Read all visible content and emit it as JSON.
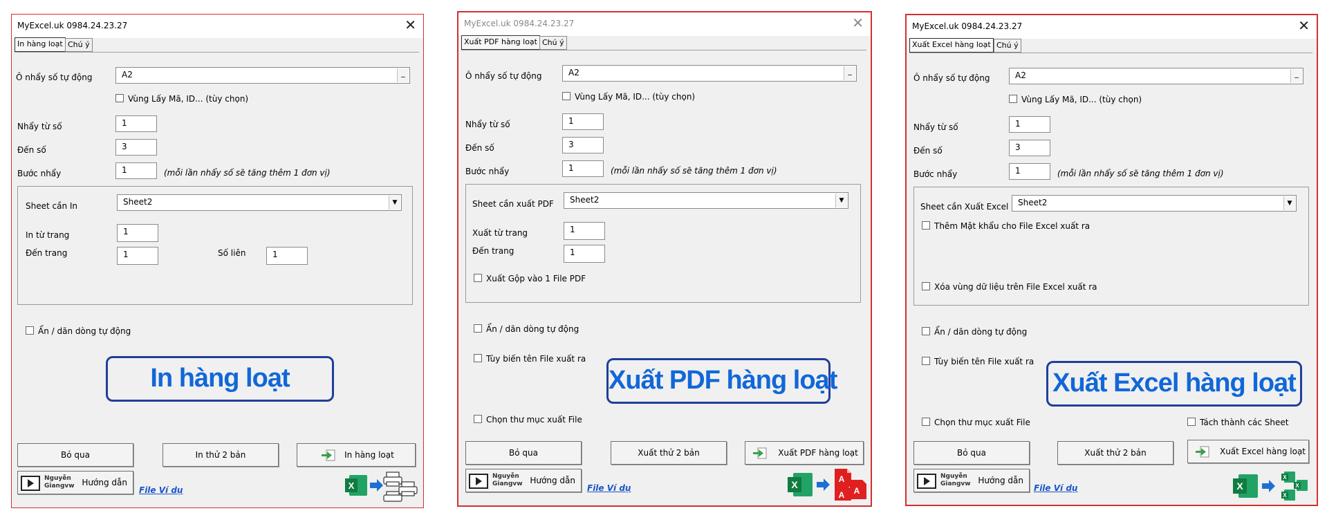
{
  "dialogs": [
    {
      "title": "MyExcel.uk     0984.24.23.27",
      "close": "✕",
      "tabs": [
        "In hàng loạt",
        "Chú ý"
      ],
      "auto_number_label": "Ô nhẩy số tự động",
      "auto_number_value": "A2",
      "id_range_checkbox": "Vùng Lấy Mã, ID... (tùy chọn)",
      "from_label": "Nhẩy từ số",
      "from_value": "1",
      "to_label": "Đến số",
      "to_value": "3",
      "step_label": "Bước nhẩy",
      "step_value": "1",
      "step_note": "(mỗi lần nhẩy số sẽ tăng thêm    1  đơn vị)",
      "sheet_label": "Sheet cần In",
      "sheet_value": "Sheet2",
      "page_from_label": "In từ trang",
      "page_from_value": "1",
      "page_to_label": "Đến trang",
      "page_to_value": "1",
      "copies_label": "Số liên",
      "copies_value": "1",
      "auto_hide_checkbox": "Ẩn / dãn dòng tự động",
      "banner": "In hàng loạt",
      "skip_button": "Bỏ qua",
      "test_button": "In thử 2 bản",
      "run_button": "In hàng loạt",
      "help_brand_line1": "Nguyễn",
      "help_brand_line2": "Giangvw",
      "help_button": "Hướng dẫn",
      "example_link": "File Ví dụ",
      "bottom_icons": [
        "excel-icon",
        "arrow-right-icon",
        "printer-icon"
      ]
    },
    {
      "title": "MyExcel.uk     0984.24.23.27",
      "close": "✕",
      "tabs": [
        "Xuất PDF hàng loạt",
        "Chú ý"
      ],
      "auto_number_label": "Ô nhẩy số tự động",
      "auto_number_value": "A2",
      "id_range_checkbox": "Vùng Lấy Mã, ID... (tùy chọn)",
      "from_label": "Nhẩy từ số",
      "from_value": "1",
      "to_label": "Đến số",
      "to_value": "3",
      "step_label": "Bước nhẩy",
      "step_value": "1",
      "step_note": "(mỗi lần nhẩy số sẽ tăng thêm    1  đơn vị)",
      "sheet_label": "Sheet cần xuất PDF",
      "sheet_value": "Sheet2",
      "page_from_label": "Xuất từ trang",
      "page_from_value": "1",
      "page_to_label": "Đến trang",
      "page_to_value": "1",
      "merge_checkbox": "Xuất Gộp vào 1 File PDF",
      "auto_hide_checkbox": "Ẩn / dãn dòng tự động",
      "rename_checkbox": "Tùy biến tên File xuất ra",
      "folder_checkbox": "Chọn thư mục xuất File",
      "banner": "Xuất PDF hàng loạt",
      "skip_button": "Bỏ qua",
      "test_button": "Xuất thử 2 bản",
      "run_button": "Xuất PDF hàng loạt",
      "help_brand_line1": "Nguyễn",
      "help_brand_line2": "Giangvw",
      "help_button": "Hướng dẫn",
      "example_link": "File Ví dụ",
      "bottom_icons": [
        "excel-icon",
        "arrow-right-icon",
        "pdf-icon"
      ]
    },
    {
      "title": "MyExcel.uk     0984.24.23.27",
      "close": "✕",
      "tabs": [
        "Xuất Excel hàng loạt",
        "Chú ý"
      ],
      "auto_number_label": "Ô nhẩy số tự động",
      "auto_number_value": "A2",
      "id_range_checkbox": "Vùng Lấy Mã, ID... (tùy chọn)",
      "from_label": "Nhẩy từ số",
      "from_value": "1",
      "to_label": "Đến số",
      "to_value": "3",
      "step_label": "Bước nhẩy",
      "step_value": "1",
      "step_note": "(mỗi lần nhẩy số sẽ tăng thêm    1  đơn vị)",
      "sheet_label": "Sheet cần Xuất Excel",
      "sheet_value": "Sheet2",
      "password_checkbox": "Thêm Mật khẩu cho File Excel xuất ra",
      "clear_checkbox": "Xóa vùng dữ liệu trên File Excel xuất ra",
      "auto_hide_checkbox": "Ẩn / dãn dòng tự động",
      "rename_checkbox": "Tùy biến tên File xuất ra",
      "folder_checkbox": "Chọn thư mục xuất File",
      "split_checkbox": "Tách thành các Sheet",
      "banner": "Xuất Excel hàng loạt",
      "skip_button": "Bỏ qua",
      "test_button": "Xuất thử 2 bản",
      "run_button": "Xuất Excel hàng loạt",
      "help_brand_line1": "Nguyễn",
      "help_brand_line2": "Giangvw",
      "help_button": "Hướng dẫn",
      "example_link": "File Ví dụ",
      "bottom_icons": [
        "excel-icon",
        "arrow-right-icon",
        "excel-files-icon"
      ]
    }
  ],
  "colors": {
    "banner_text": "#1167d8",
    "banner_border": "#1f3f9a",
    "dialog_border": "#d32f2f",
    "excel_green": "#1f7a45",
    "pdf_red": "#e02020"
  }
}
